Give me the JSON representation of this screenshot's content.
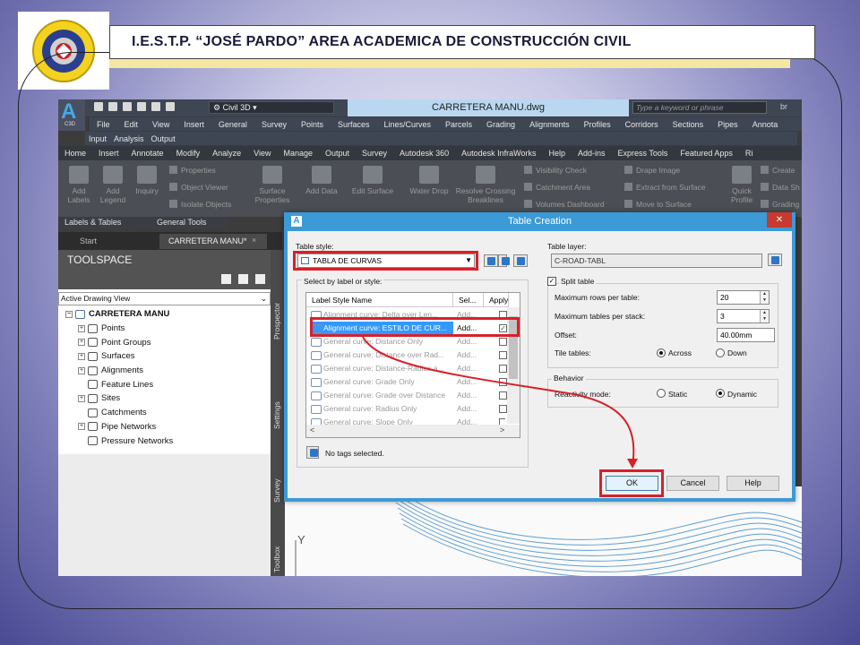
{
  "slide": {
    "header_title": "I.E.S.T.P. “JOSÉ PARDO” AREA ACADEMICA DE CONSTRUCCIÓN CIVIL",
    "accent_red": "#d8202a",
    "gold": "#f4e7a2"
  },
  "app": {
    "logo_letter": "A",
    "logo_sub": "C3D",
    "workspace": "Civil 3D",
    "doc_title": "CARRETERA MANU.dwg",
    "search_placeholder": "Type a keyword or phrase",
    "user": "br",
    "menu_row1": [
      "File",
      "Edit",
      "View",
      "Insert",
      "General",
      "Survey",
      "Points",
      "Surfaces",
      "Lines/Curves",
      "Parcels",
      "Grading",
      "Alignments",
      "Profiles",
      "Corridors",
      "Sections",
      "Pipes",
      "Annota"
    ],
    "menu_row2": [
      "Input",
      "Analysis",
      "Output"
    ],
    "ribbon_tabs": [
      "Home",
      "Insert",
      "Annotate",
      "Modify",
      "Analyze",
      "View",
      "Manage",
      "Output",
      "Survey",
      "Autodesk 360",
      "Autodesk InfraWorks",
      "Help",
      "Add-ins",
      "Express Tools",
      "Featured Apps",
      "Ri"
    ],
    "ribbon": {
      "add_labels": "Add Labels",
      "add_legend": "Add Legend",
      "inquiry": "Inquiry",
      "properties": "Properties",
      "object_viewer": "Object Viewer",
      "isolate_objects": "Isolate Objects",
      "surface_properties": "Surface Properties",
      "add_data": "Add Data",
      "edit_surface": "Edit Surface",
      "water_drop": "Water Drop",
      "resolve_crossing": "Resolve Crossing Breaklines",
      "visibility_check": "Visibility Check",
      "catchment_area": "Catchment Area",
      "volumes_dashboard": "Volumes Dashboard",
      "drape_image": "Drape Image",
      "extract_from_surface": "Extract from Surface",
      "move_to_surface": "Move to Surface",
      "quick_profile": "Quick Profile",
      "create": "Create",
      "data_sh": "Data Sh",
      "grading": "Grading",
      "panel_labels_tables": "Labels & Tables",
      "panel_general_tools": "General Tools"
    },
    "tabs": {
      "start": "Start",
      "doc": "CARRETERA MANU*",
      "close": "×",
      "add": "+"
    }
  },
  "toolspace": {
    "title": "TOOLSPACE",
    "view": "Active Drawing View",
    "root": "CARRETERA MANU",
    "items": [
      "Points",
      "Point Groups",
      "Surfaces",
      "Alignments",
      "Feature Lines",
      "Sites",
      "Catchments",
      "Pipe Networks",
      "Pressure Networks"
    ],
    "side_tabs": [
      "Prospector",
      "Settings",
      "Survey",
      "Toolbox"
    ]
  },
  "dialog": {
    "title": "Table Creation",
    "close": "✕",
    "table_style_label": "Table style:",
    "table_style_value": "TABLA DE CURVAS",
    "table_layer_label": "Table layer:",
    "table_layer_value": "C-ROAD-TABL",
    "select_by_label": "Select by label or style:",
    "col_label_style": "Label Style Name",
    "col_sel": "Sel...",
    "col_apply": "Apply",
    "rows": [
      {
        "name": "Alignment curve: Delta over Len...",
        "sel": "Add...",
        "apply": false
      },
      {
        "name": "Alignment curve: ESTILO DE CUR...",
        "sel": "Add...",
        "apply": true
      },
      {
        "name": "General curve: Distance Only",
        "sel": "Add...",
        "apply": false
      },
      {
        "name": "General curve: Distance over Rad...",
        "sel": "Add...",
        "apply": false
      },
      {
        "name": "General curve: Distance-Radius a...",
        "sel": "Add...",
        "apply": false
      },
      {
        "name": "General curve: Grade Only",
        "sel": "Add...",
        "apply": false
      },
      {
        "name": "General curve: Grade over Distance",
        "sel": "Add...",
        "apply": false
      },
      {
        "name": "General curve: Radius Only",
        "sel": "Add...",
        "apply": false
      },
      {
        "name": "General curve: Slope Only",
        "sel": "Add...",
        "apply": false
      }
    ],
    "scroll_left": "<",
    "scroll_right": ">",
    "no_tags": "No tags selected.",
    "split_table": "Split table",
    "max_rows_label": "Maximum rows per table:",
    "max_rows_value": "20",
    "max_tables_label": "Maximum tables per stack:",
    "max_tables_value": "3",
    "offset_label": "Offset:",
    "offset_value": "40.00mm",
    "tile_tables_label": "Tile tables:",
    "across": "Across",
    "down": "Down",
    "behavior": "Behavior",
    "reactivity_label": "Reactivity mode:",
    "static": "Static",
    "dynamic": "Dynamic",
    "ok": "OK",
    "cancel": "Cancel",
    "help": "Help"
  },
  "drawing": {
    "axis_y": "Y"
  }
}
